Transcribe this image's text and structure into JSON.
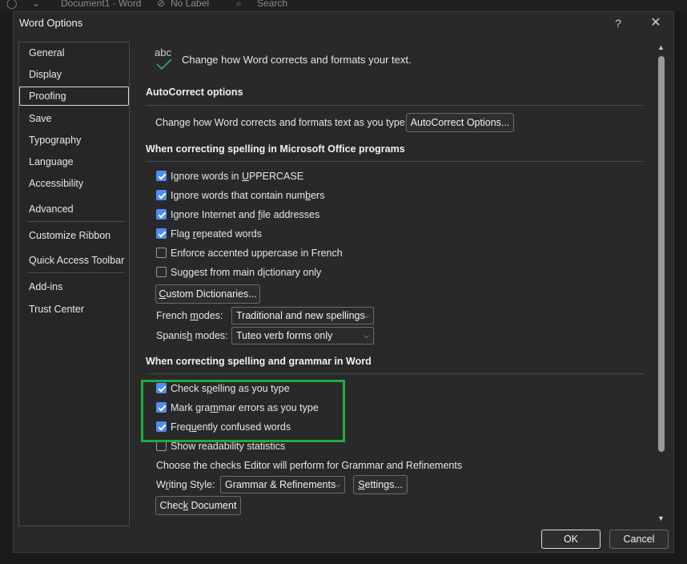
{
  "background": {
    "doc_title": "Document1  -  Word",
    "label": "No Label",
    "search": "Search"
  },
  "dialog": {
    "title": "Word Options",
    "help": "?",
    "close": "✕"
  },
  "nav": {
    "selected_index": 2,
    "items": [
      {
        "label": "General"
      },
      {
        "label": "Display"
      },
      {
        "label": "Proofing"
      },
      {
        "label": "Save"
      },
      {
        "label": "Typography"
      },
      {
        "label": "Language"
      },
      {
        "label": "Accessibility"
      },
      {
        "label": "Advanced"
      },
      {
        "label": "Customize Ribbon"
      },
      {
        "label": "Quick Access Toolbar"
      },
      {
        "label": "Add-ins"
      },
      {
        "label": "Trust Center"
      }
    ]
  },
  "header": {
    "icon_text": "abc",
    "text": "Change how Word corrects and formats your text."
  },
  "autocorrect": {
    "heading": "AutoCorrect options",
    "label": "Change how Word corrects and formats text as you type:",
    "button": "AutoCorrect Options..."
  },
  "office": {
    "heading": "When correcting spelling in Microsoft Office programs",
    "options": [
      {
        "pre": "Ignore words in ",
        "key": "U",
        "post": "PPERCASE",
        "checked": true
      },
      {
        "pre": "Ignore words that contain num",
        "key": "b",
        "post": "ers",
        "checked": true
      },
      {
        "pre": "Ignore Internet and ",
        "key": "f",
        "post": "ile addresses",
        "checked": true
      },
      {
        "pre": "Flag ",
        "key": "r",
        "post": "epeated words",
        "checked": true
      },
      {
        "pre": "Enforce accented uppercase in French",
        "key": "",
        "post": "",
        "checked": false
      },
      {
        "pre": "Suggest from main d",
        "key": "i",
        "post": "ctionary only",
        "checked": false
      }
    ],
    "custom_dict_pre": "",
    "custom_dict_key": "C",
    "custom_dict_post": "ustom Dictionaries...",
    "french_pre": "French ",
    "french_key": "m",
    "french_post": "odes:",
    "french_value": "Traditional and new spellings",
    "spanish_pre": "Spanis",
    "spanish_key": "h",
    "spanish_post": " modes:",
    "spanish_value": "Tuteo verb forms only"
  },
  "word": {
    "heading": "When correcting spelling and grammar in Word",
    "options": [
      {
        "pre": "Check s",
        "key": "p",
        "post": "elling as you type",
        "checked": true
      },
      {
        "pre": "Mark gra",
        "key": "m",
        "post": "mar errors as you type",
        "checked": true
      },
      {
        "pre": "Freq",
        "key": "u",
        "post": "ently confused words",
        "checked": true
      },
      {
        "pre": "Show readability statistics",
        "key": "",
        "post": "",
        "checked": false
      }
    ],
    "checks_label": "Choose the checks Editor will perform for Grammar and Refinements",
    "style_pre": "W",
    "style_key": "r",
    "style_post": "iting Style:",
    "style_value": "Grammar & Refinements",
    "settings_pre": "",
    "settings_key": "S",
    "settings_post": "ettings...",
    "check_doc_pre": "Chec",
    "check_doc_key": "k",
    "check_doc_post": " Document"
  },
  "footer": {
    "ok": "OK",
    "cancel": "Cancel"
  },
  "colors": {
    "checkbox_on": "#4f8df5",
    "highlight": "#22a93f",
    "dialog_bg": "#292929"
  }
}
